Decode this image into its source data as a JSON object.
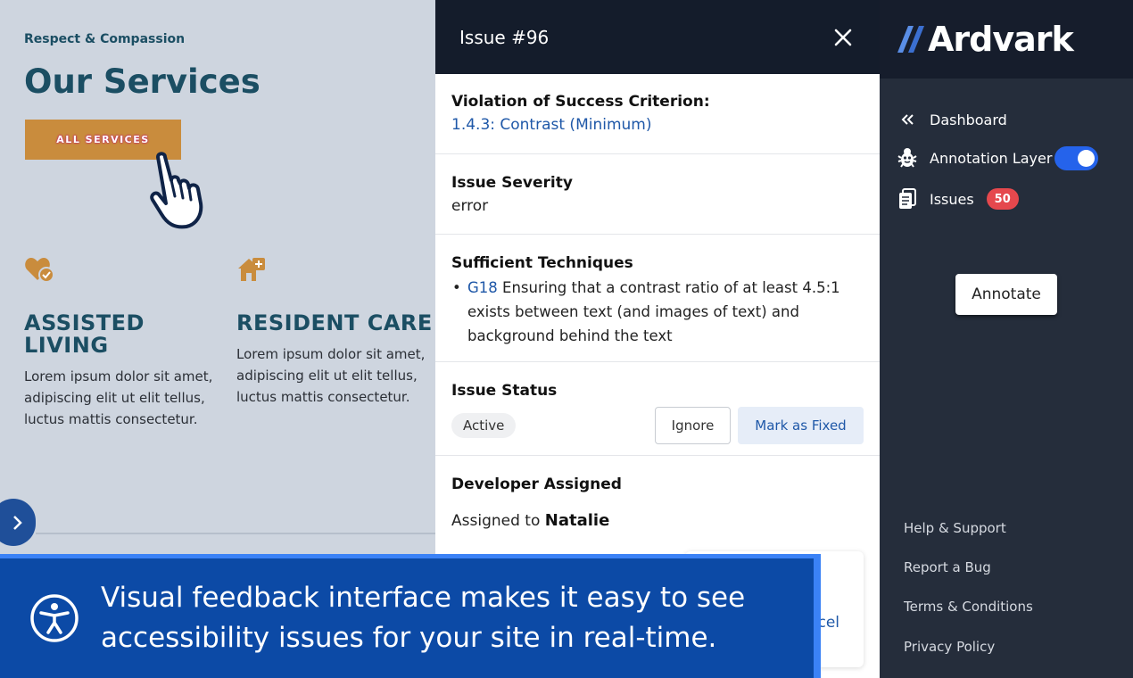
{
  "site": {
    "eyebrow": "Respect & Compassion",
    "title": "Our Services",
    "cta_label": "ALL SERVICES",
    "services": [
      {
        "title": "ASSISTED LIVING",
        "body": "Lorem ipsum dolor sit amet, adipiscing elit ut elit tellus, luctus mattis consectetur."
      },
      {
        "title": "RESIDENT CARE",
        "body": "Lorem ipsum dolor sit amet, adipiscing elit ut elit tellus, luctus mattis consectetur."
      }
    ]
  },
  "panel": {
    "title": "Issue #96",
    "violation": {
      "label": "Violation of Success Criterion:",
      "value": "1.4.3: Contrast (Minimum)"
    },
    "severity": {
      "label": "Issue Severity",
      "value": "error"
    },
    "techniques": {
      "label": "Sufficient Techniques",
      "items": [
        {
          "code": "G18",
          "text": " Ensuring that a contrast ratio of at least 4.5:1 exists between text (and images of text) and background behind the text"
        }
      ]
    },
    "status": {
      "label": "Issue Status",
      "value": "Active",
      "ignore_label": "Ignore",
      "fixed_label": "Mark as Fixed"
    },
    "developer": {
      "label": "Developer Assigned",
      "prefix": "Assigned to ",
      "name": "Natalie"
    },
    "cancel_partial": "cel"
  },
  "sidebar": {
    "brand": "Ardvark",
    "nav": {
      "dashboard": "Dashboard",
      "annotation_layer": "Annotation Layer",
      "issues": "Issues",
      "issues_count": "50"
    },
    "annotation_layer_on": true,
    "annotate_label": "Annotate",
    "footer": [
      "Help & Support",
      "Report a Bug",
      "Terms & Conditions",
      "Privacy Policy"
    ]
  },
  "banner": {
    "text": "Visual feedback interface makes it easy to see accessibility issues for your site in real-time."
  },
  "colors": {
    "navy": "#141c2b",
    "sidebar": "#252d3b",
    "accent": "#2563eb",
    "banner": "#0c4aa6",
    "badge": "#e5484d",
    "site_teal": "#1b4e63",
    "site_orange": "#c98c3d"
  }
}
